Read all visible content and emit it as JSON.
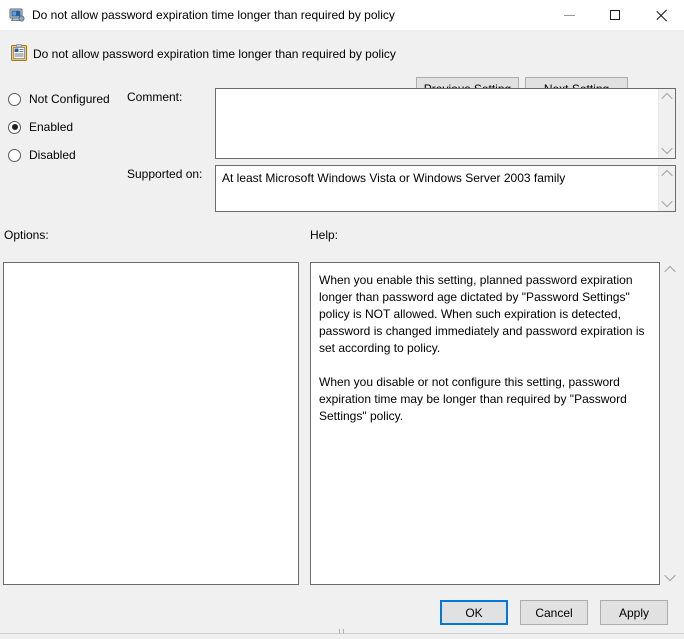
{
  "window": {
    "title": "Do not allow password expiration time longer than required by policy",
    "title_icon": "computer-policy-icon",
    "controls": {
      "minimize": "minimize-icon",
      "maximize": "maximize-icon",
      "close": "close-icon"
    }
  },
  "header": {
    "icon": "policy-setting-icon",
    "title": "Do not allow password expiration time longer than required by policy",
    "previous_setting_label": "Previous Setting",
    "next_setting_label": "Next Setting"
  },
  "state": {
    "options": [
      {
        "id": "not-configured",
        "label": "Not Configured",
        "selected": false
      },
      {
        "id": "enabled",
        "label": "Enabled",
        "selected": true
      },
      {
        "id": "disabled",
        "label": "Disabled",
        "selected": false
      }
    ]
  },
  "comment": {
    "label": "Comment:",
    "value": "",
    "placeholder": ""
  },
  "supported_on": {
    "label": "Supported on:",
    "value": "At least Microsoft Windows Vista or Windows Server 2003 family"
  },
  "options_panel": {
    "label": "Options:",
    "content": ""
  },
  "help_panel": {
    "label": "Help:",
    "paragraphs": [
      "When you enable this setting, planned password expiration longer than password age dictated by \"Password Settings\" policy is NOT allowed. When such expiration is detected, password is changed immediately and password expiration is set according to policy.",
      "When you disable or not configure this setting, password expiration time may be longer than required by \"Password Settings\" policy."
    ]
  },
  "footer": {
    "ok_label": "OK",
    "cancel_label": "Cancel",
    "apply_label": "Apply"
  },
  "colors": {
    "accent": "#0078d7",
    "window_background": "#f0f0f0",
    "field_background": "#ffffff",
    "button_face": "#e1e1e1",
    "border": "#6b6b6b"
  }
}
